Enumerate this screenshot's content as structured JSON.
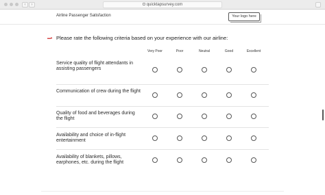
{
  "browser": {
    "url": "quicktapsurvey.com"
  },
  "header": {
    "title": "Airline Passenger Satisfaction",
    "logo_label": "Your logo here"
  },
  "question": {
    "text": "Please rate the following criteria based on your experience with our airline:",
    "columns": [
      "Very Poor",
      "Poor",
      "Neutral",
      "Good",
      "Excellent"
    ],
    "rows": [
      {
        "label": "Service quality of flight attendants in assisting passengers"
      },
      {
        "label": "Communication of crew during the flight"
      },
      {
        "label": "Quality of food and beverages during the flight"
      },
      {
        "label": "Availability and choice of in-flight entertainment"
      },
      {
        "label": "Availability of blankets, pillows, earphones, etc. during the flight"
      }
    ]
  },
  "colors": {
    "marker": "#d64545",
    "radio_border": "#555555",
    "divider": "#e3e3e3"
  }
}
